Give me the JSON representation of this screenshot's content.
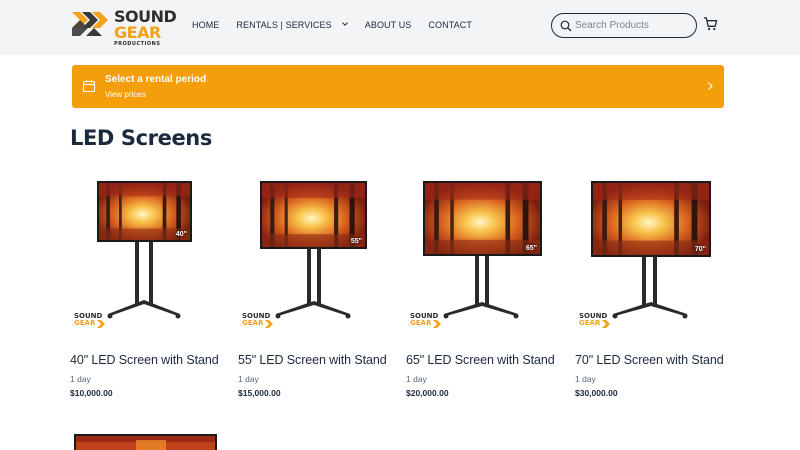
{
  "header": {
    "logo": {
      "line1": "SOUND",
      "line2": "GEAR",
      "line3": "PRODUCTIONS",
      "brand_dark": "#2e2e2e",
      "brand_orange": "#f2a31b"
    },
    "nav": [
      {
        "label": "HOME"
      },
      {
        "label": "RENTALS | SERVICES",
        "has_dropdown": true
      },
      {
        "label": "ABOUT US"
      },
      {
        "label": "CONTACT"
      }
    ],
    "search": {
      "placeholder": "Search Products",
      "value": "",
      "icon": "search-icon"
    },
    "cart_icon": "cart-icon"
  },
  "banner": {
    "title": "Select a rental period",
    "subtitle": "View prices",
    "icon": "calendar-icon",
    "arrow_icon": "chevron-right-icon",
    "color": "#f59e0b"
  },
  "section_title": "LED Screens",
  "products": [
    {
      "name": "40\" LED Screen with Stand",
      "duration": "1 day",
      "price": "$10,000.00",
      "size_label": "40\""
    },
    {
      "name": "55\" LED Screen with Stand",
      "duration": "1 day",
      "price": "$15,000.00",
      "size_label": "55\""
    },
    {
      "name": "65\" LED Screen with Stand",
      "duration": "1 day",
      "price": "$20,000.00",
      "size_label": "65\""
    },
    {
      "name": "70\" LED Screen with Stand",
      "duration": "1 day",
      "price": "$30,000.00",
      "size_label": "70\""
    }
  ],
  "product_logo": {
    "line1": "SOUND",
    "line2": "GEAR"
  }
}
